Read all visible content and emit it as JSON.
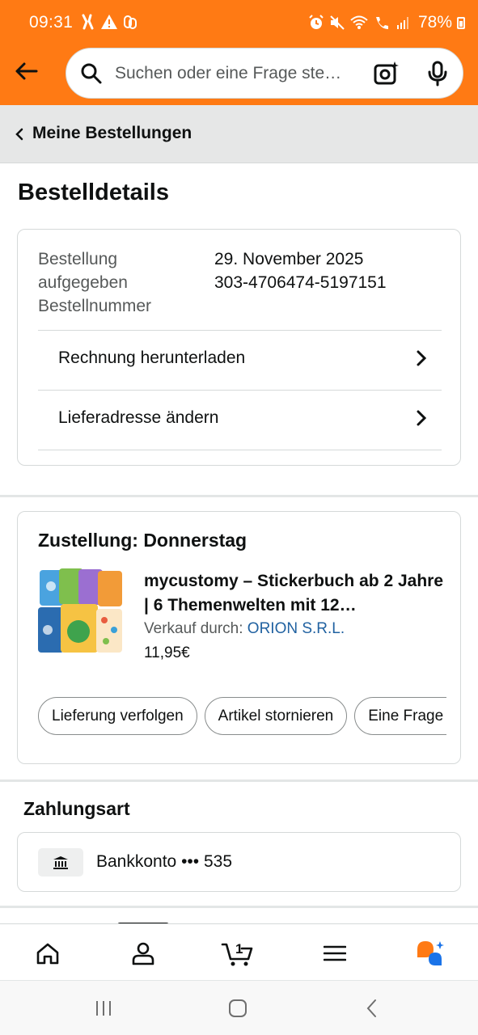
{
  "status": {
    "time": "09:31",
    "battery": "78%"
  },
  "header": {
    "search_placeholder": "Suchen oder eine Frage ste…"
  },
  "breadcrumb": {
    "label": "Meine Bestellungen"
  },
  "page": {
    "title": "Bestelldetails"
  },
  "order": {
    "placed_label": "Bestellung aufgegeben",
    "number_label": "Bestellnummer",
    "placed_value": "29. November 2025",
    "number_value": "303-4706474-5197151",
    "actions": [
      {
        "label": "Rechnung herunterladen"
      },
      {
        "label": "Lieferadresse ändern"
      }
    ]
  },
  "shipment": {
    "delivery": "Zustellung: Donnerstag",
    "product_title": "mycustomy – Stickerbuch ab 2 Jahre | 6 Themenwelten mit 12…",
    "seller_prefix": "Verkauf durch: ",
    "seller_name": "ORION S.R.L.",
    "price": "11,95€",
    "buttons": [
      {
        "label": "Lieferung verfolgen"
      },
      {
        "label": "Artikel stornieren"
      },
      {
        "label": "Eine Frage zum Produkt stellen"
      }
    ]
  },
  "payment": {
    "title": "Zahlungsart",
    "method": "Bankkonto ••• 535"
  },
  "bottom_nav": {
    "cart_count": "1",
    "items": [
      "home-icon",
      "account-icon",
      "cart-icon",
      "menu-icon",
      "rufus-icon"
    ]
  },
  "colors": {
    "header": "#ff7a14",
    "link": "#2162a1",
    "breadcrumb_bg": "#e6e7e7"
  }
}
